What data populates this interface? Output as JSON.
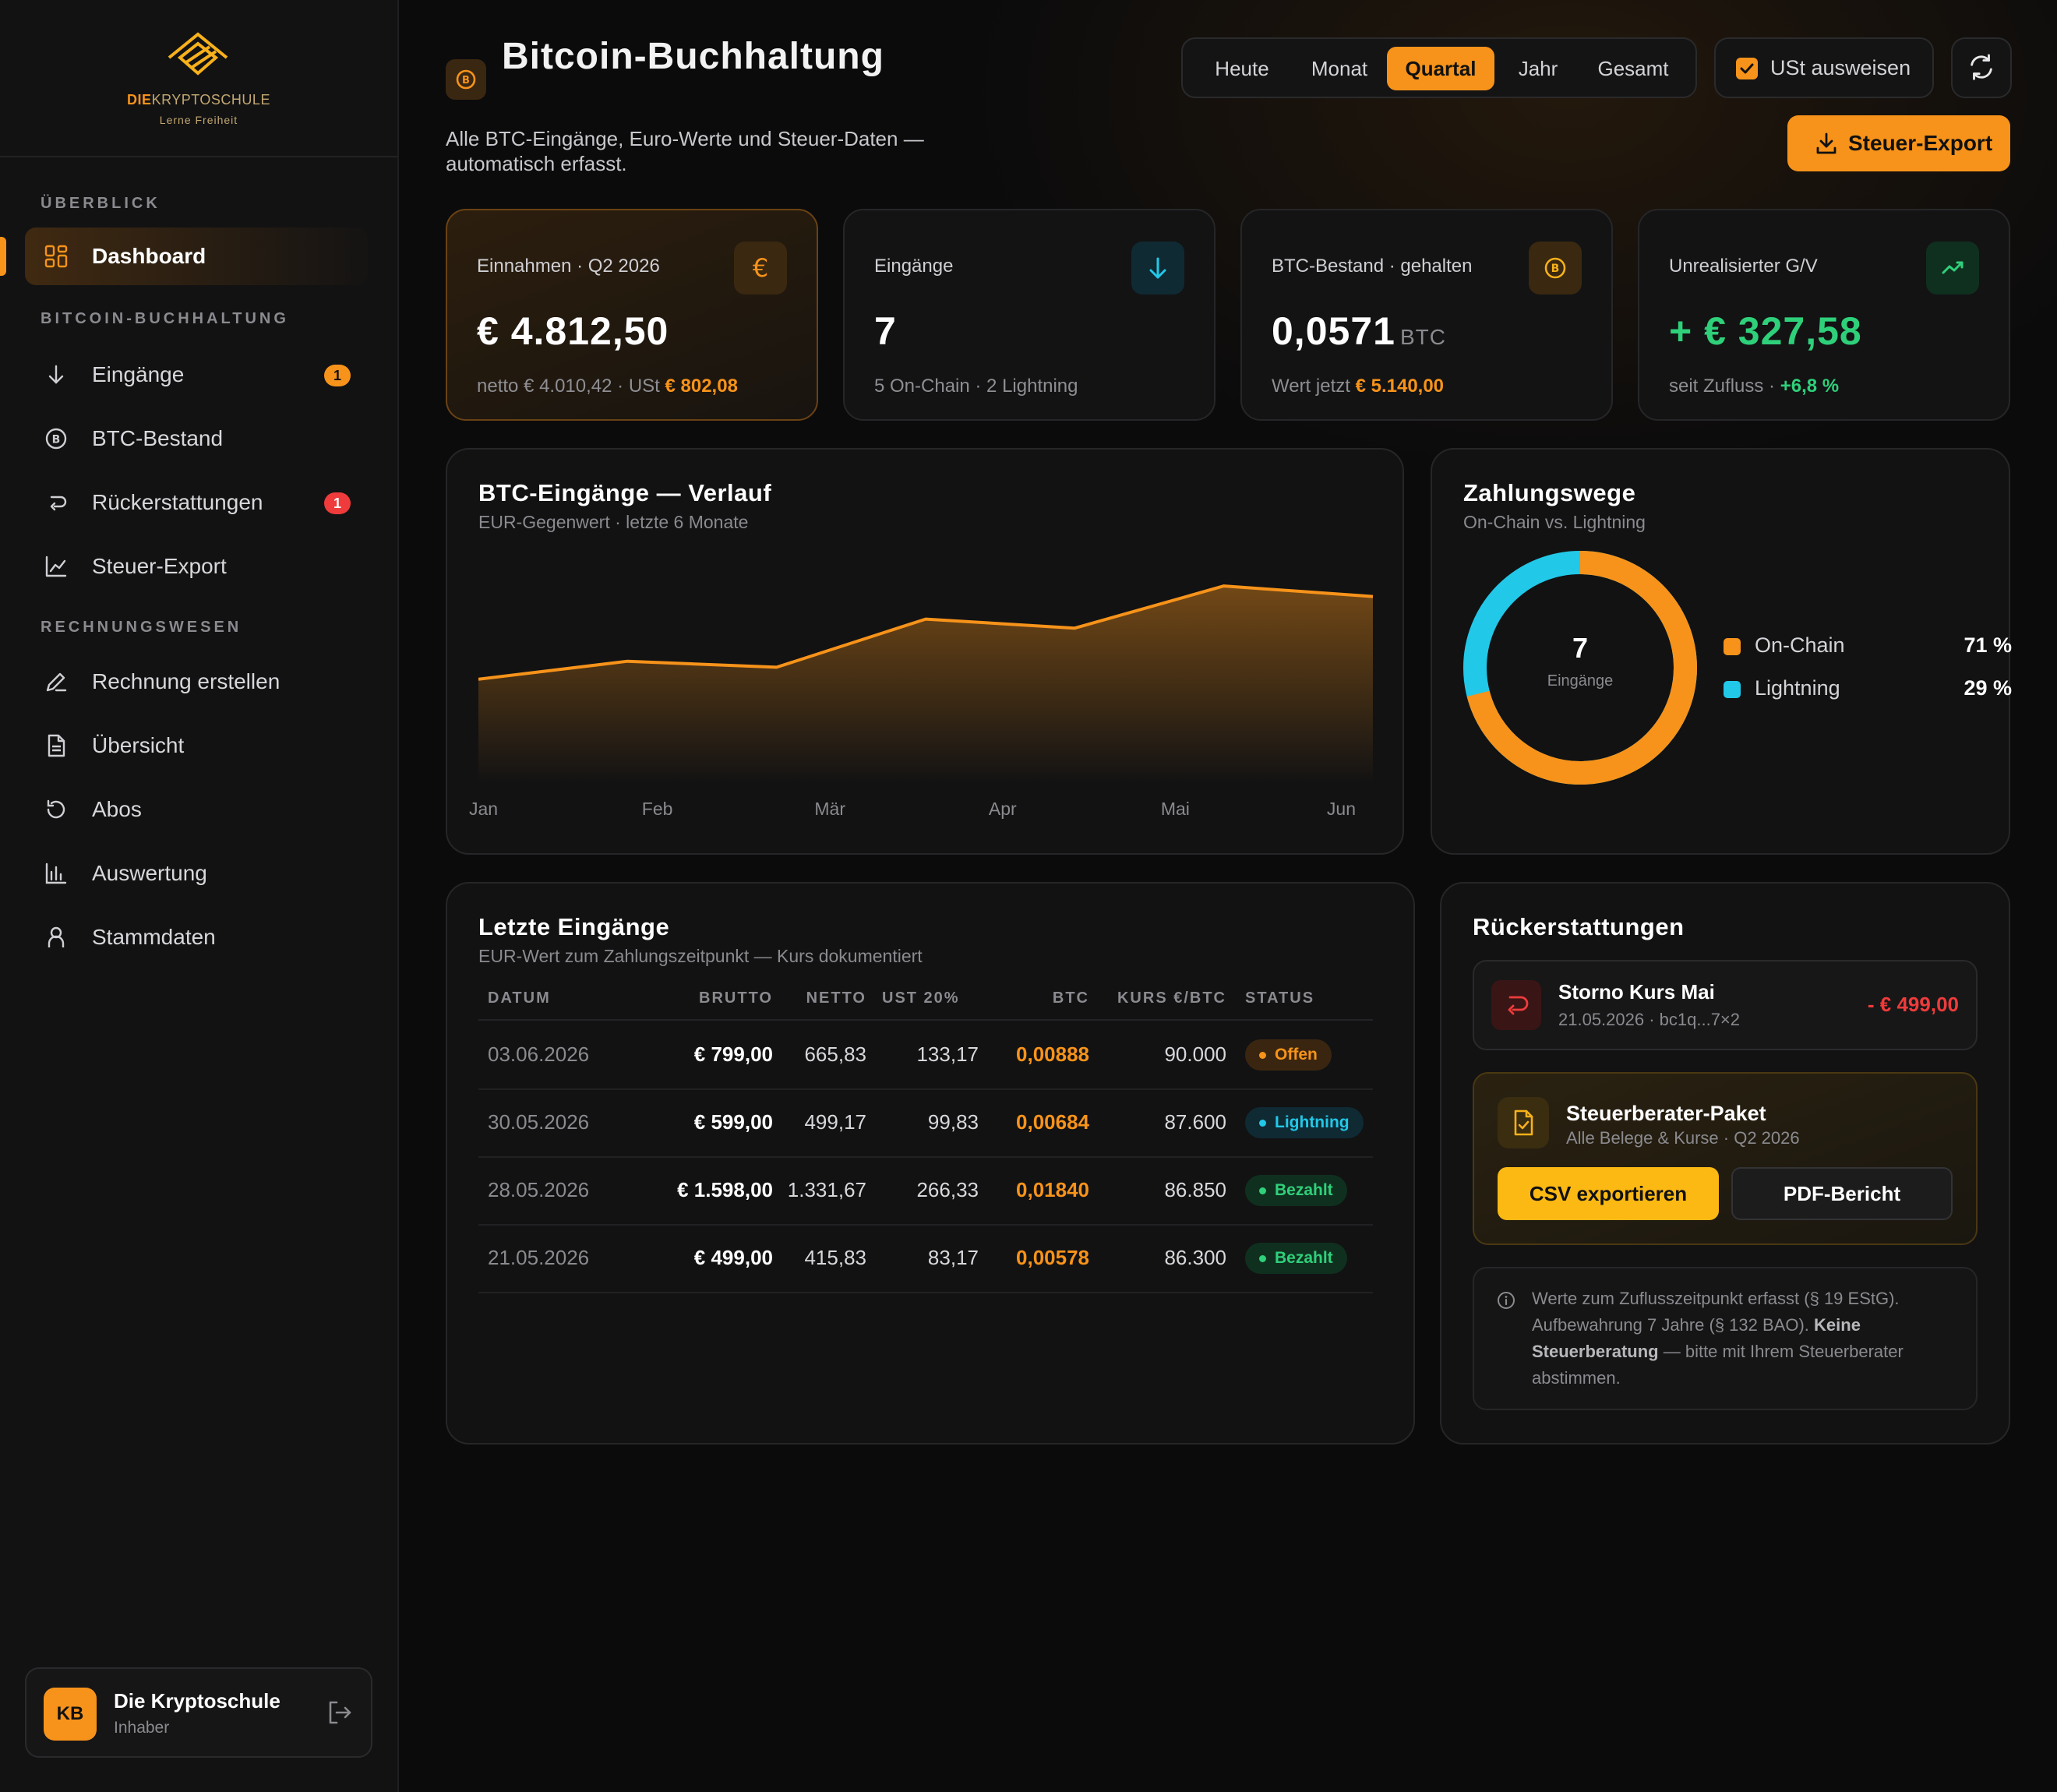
{
  "brand": {
    "name_part1": "DIE",
    "name_part2": "KRYPTOSCHULE",
    "tagline": "Lerne Freiheit"
  },
  "sidebar": {
    "sections": [
      {
        "title": "ÜBERBLICK"
      },
      {
        "title": "BITCOIN-BUCHHALTUNG"
      },
      {
        "title": "RECHNUNGSWESEN"
      }
    ],
    "items": [
      {
        "label": "Dashboard",
        "icon": "dashboard-grid-icon",
        "active": true
      },
      {
        "label": "Eingänge",
        "icon": "arrow-down-icon",
        "badge": "1",
        "badge_color": "#f7931a"
      },
      {
        "label": "BTC-Bestand",
        "icon": "bitcoin-icon"
      },
      {
        "label": "Rückerstattungen",
        "icon": "return-arrow-icon",
        "badge": "1",
        "badge_color": "#ef3b3b"
      },
      {
        "label": "Steuer-Export",
        "icon": "line-chart-icon"
      },
      {
        "label": "Rechnung erstellen",
        "icon": "pen-icon"
      },
      {
        "label": "Übersicht",
        "icon": "document-icon"
      },
      {
        "label": "Abos",
        "icon": "refresh-icon"
      },
      {
        "label": "Auswertung",
        "icon": "bar-chart-icon"
      },
      {
        "label": "Stammdaten",
        "icon": "user-icon"
      }
    ],
    "user": {
      "initials": "KB",
      "name": "Die Kryptoschule",
      "role": "Inhaber"
    }
  },
  "header": {
    "title": "Bitcoin-Buchhaltung",
    "subtitle": "Alle BTC-Eingänge, Euro-Werte und Steuer-Daten — automatisch erfasst.",
    "periods": [
      "Heute",
      "Monat",
      "Quartal",
      "Jahr",
      "Gesamt"
    ],
    "active_period": "Quartal",
    "ust_label": "USt ausweisen",
    "ust_checked": true,
    "export_label": "Steuer-Export"
  },
  "kpis": [
    {
      "label": "Einnahmen · Q2 2026",
      "value": "€ 4.812,50",
      "sub_text": "netto € 4.010,42 · USt",
      "sub_highlight": "€ 802,08",
      "icon": "euro-icon"
    },
    {
      "label": "Eingänge",
      "value": "7",
      "sub_text": "5 On-Chain · 2 Lightning",
      "sub_highlight": "",
      "icon": "arrow-down-icon"
    },
    {
      "label": "BTC-Bestand · gehalten",
      "value": "0,0571",
      "unit": "BTC",
      "sub_text": "Wert jetzt",
      "sub_highlight": "€ 5.140,00",
      "icon": "bitcoin-icon"
    },
    {
      "label": "Unrealisierter G/V",
      "value": "+ € 327,58",
      "sub_text": "seit Zufluss ·",
      "sub_highlight": "+6,8 %",
      "icon": "trend-up-icon"
    }
  ],
  "chart_panel": {
    "title": "BTC-Eingänge — Verlauf",
    "subtitle": "EUR-Gegenwert · letzte 6 Monate"
  },
  "chart_data": {
    "type": "area",
    "categories": [
      "Jan",
      "Feb",
      "Mär",
      "Apr",
      "Mai",
      "Jun"
    ],
    "values": [
      1.0,
      2.2,
      1.8,
      5.0,
      4.4,
      7.2,
      6.5
    ],
    "x": [
      "Jan",
      "Feb",
      "Mär",
      "Apr",
      "Apr–Mai",
      "Mai",
      "Jun"
    ],
    "ylim": [
      -6,
      8.5
    ],
    "grid": false,
    "color": "#f7931a"
  },
  "donut_panel": {
    "title": "Zahlungswege",
    "subtitle": "On-Chain vs. Lightning",
    "center_value": "7",
    "center_label": "Eingänge",
    "segments": [
      {
        "name": "On-Chain",
        "percent_label": "71 %",
        "value": 71,
        "color": "#f7931a"
      },
      {
        "name": "Lightning",
        "percent_label": "29 %",
        "value": 29,
        "color": "#22c8e8"
      }
    ]
  },
  "table": {
    "title": "Letzte Eingänge",
    "subtitle": "EUR-Wert zum Zahlungszeitpunkt — Kurs dokumentiert",
    "columns": [
      "DATUM",
      "BRUTTO",
      "NETTO",
      "UST 20%",
      "BTC",
      "KURS €/BTC",
      "STATUS"
    ],
    "rows": [
      {
        "date": "03.06.2026",
        "brutto": "€ 799,00",
        "netto": "665,83",
        "ust": "133,17",
        "btc": "0,00888",
        "kurs": "90.000",
        "status": "Offen",
        "status_color": "#f7931a",
        "status_bg": "#3a2610"
      },
      {
        "date": "30.05.2026",
        "brutto": "€ 599,00",
        "netto": "499,17",
        "ust": "99,83",
        "btc": "0,00684",
        "kurs": "87.600",
        "status": "Lightning",
        "status_color": "#22c8e8",
        "status_bg": "#0f2a33"
      },
      {
        "date": "28.05.2026",
        "brutto": "€ 1.598,00",
        "netto": "1.331,67",
        "ust": "266,33",
        "btc": "0,01840",
        "kurs": "86.850",
        "status": "Bezahlt",
        "status_color": "#2fd07a",
        "status_bg": "#10301f"
      },
      {
        "date": "21.05.2026",
        "brutto": "€ 499,00",
        "netto": "415,83",
        "ust": "83,17",
        "btc": "0,00578",
        "kurs": "86.300",
        "status": "Bezahlt",
        "status_color": "#2fd07a",
        "status_bg": "#10301f"
      }
    ]
  },
  "refunds": {
    "title": "Rückerstattungen",
    "item": {
      "title": "Storno Kurs Mai",
      "meta": "21.05.2026 · bc1q...7×2",
      "amount": "- € 499,00"
    },
    "package": {
      "title": "Steuerberater-Paket",
      "subtitle": "Alle Belege & Kurse · Q2 2026",
      "btn_csv": "CSV exportieren",
      "btn_pdf": "PDF-Bericht"
    },
    "note": {
      "text1": "Werte zum Zuflusszeitpunkt erfasst (§ 19 EStG). Aufbewahrung 7 Jahre (§ 132 BAO).",
      "bold": "Keine Steuerberatung",
      "text2": "— bitte mit Ihrem Steuerberater abstimmen."
    }
  }
}
